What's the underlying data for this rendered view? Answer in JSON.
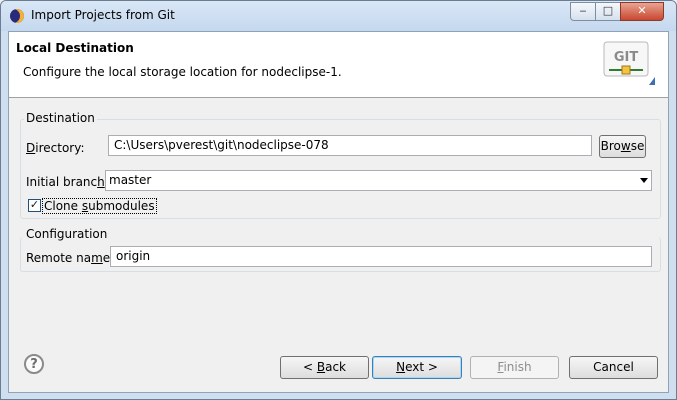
{
  "window": {
    "title": "Import Projects from Git",
    "controls": {
      "minimize": "‒",
      "maximize": "□",
      "close": "✕"
    }
  },
  "header": {
    "title": "Local Destination",
    "description": "Configure the local storage location for nodeclipse-1.",
    "logo_text": "GIT"
  },
  "destination": {
    "group_title": "Destination",
    "directory": {
      "label_pre": "",
      "label_mnemonic": "D",
      "label_post": "irectory:",
      "value": "C:\\Users\\pverest\\git\\nodeclipse-078"
    },
    "browse": {
      "label_pre": "Bro",
      "label_mnemonic": "w",
      "label_post": "se"
    },
    "initial_branch": {
      "label_pre": "Initial branc",
      "label_mnemonic": "h",
      "label_post": ":",
      "value": "master"
    },
    "clone_submodules": {
      "checked": true,
      "check_mark": "✓",
      "label_pre": "Clone ",
      "label_mnemonic": "s",
      "label_post": "ubmodules"
    }
  },
  "configuration": {
    "group_title": "Configuration",
    "remote_name": {
      "label_pre": "Remote na",
      "label_mnemonic": "m",
      "label_post": "e:",
      "value": "origin"
    }
  },
  "footer": {
    "help_icon": "?",
    "back": {
      "label_pre": "< ",
      "label_mnemonic": "B",
      "label_post": "ack"
    },
    "next": {
      "label_pre": "",
      "label_mnemonic": "N",
      "label_post": "ext >"
    },
    "finish": {
      "label_pre": "",
      "label_mnemonic": "F",
      "label_post": "inish",
      "enabled": false
    },
    "cancel": {
      "label": "Cancel"
    }
  },
  "colors": {
    "window_frame": "#cfdff0",
    "dialog_background": "#f0f0f0",
    "header_background": "#ffffff",
    "default_button_border": "#3c7fb1",
    "disabled_text": "#8d8d8d"
  }
}
